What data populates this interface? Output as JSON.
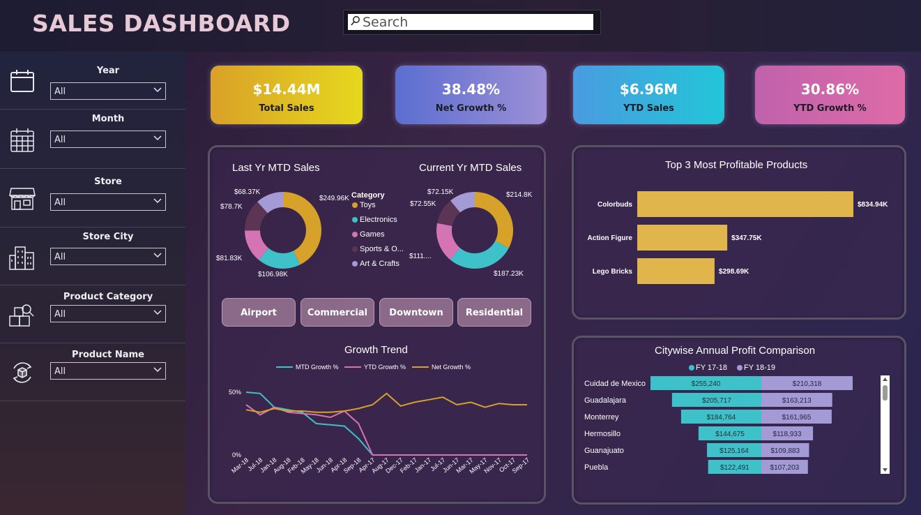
{
  "header": {
    "title": "SALES DASHBOARD",
    "search_placeholder": "Search"
  },
  "filters": [
    {
      "label": "Year",
      "value": "All",
      "icon": "calendar-icon"
    },
    {
      "label": "Month",
      "value": "All",
      "icon": "calendar-grid-icon"
    },
    {
      "label": "Store",
      "value": "All",
      "icon": "storefront-icon"
    },
    {
      "label": "Store City",
      "value": "All",
      "icon": "buildings-icon"
    },
    {
      "label": "Product Category",
      "value": "All",
      "icon": "boxes-search-icon"
    },
    {
      "label": "Product Name",
      "value": "All",
      "icon": "box-cycle-icon"
    }
  ],
  "kpis": [
    {
      "value": "$14.44M",
      "label": "Total Sales",
      "gradient": [
        "#d9a128",
        "#e6d81e"
      ]
    },
    {
      "value": "38.48%",
      "label": "Net Growth %",
      "gradient": [
        "#5b6ed0",
        "#9c8fd6"
      ]
    },
    {
      "value": "$6.96M",
      "label": "YTD Sales",
      "gradient": [
        "#4a9be0",
        "#22c6d8"
      ]
    },
    {
      "value": "30.86%",
      "label": "YTD Growth %",
      "gradient": [
        "#c062ac",
        "#de6ba8"
      ]
    }
  ],
  "colors": {
    "toys": "#d7a22a",
    "electronics": "#3ec1c9",
    "games": "#d474b5",
    "sports": "#5b3553",
    "art": "#a49bd6",
    "bar": "#e0b54c",
    "fy1718": "#3ec1c9",
    "fy1819": "#a49bd6",
    "mtd": "#3ec1c9",
    "ytd": "#d474b5",
    "net": "#d7a22a"
  },
  "donuts": {
    "legend_title": "Category",
    "categories": [
      "Toys",
      "Electronics",
      "Games",
      "Sports & O...",
      "Art & Crafts"
    ],
    "last_yr": {
      "title": "Last Yr MTD Sales",
      "values": [
        249.96,
        106.98,
        81.83,
        78.7,
        68.37
      ],
      "labels": [
        "$249.96K",
        "$106.98K",
        "$81.83K",
        "$78.7K",
        "$68.37K"
      ]
    },
    "current_yr": {
      "title": "Current Yr MTD Sales",
      "values": [
        214.8,
        187.23,
        111.0,
        72.55,
        72.15
      ],
      "labels": [
        "$214.8K",
        "$187.23K",
        "$111....",
        "$72.55K",
        "$72.15K"
      ]
    }
  },
  "stores": [
    "Airport",
    "Commercial",
    "Downtown",
    "Residential"
  ],
  "chart_data": [
    {
      "type": "bar",
      "title": "Top 3 Most Profitable Products",
      "categories": [
        "Colorbuds",
        "Action Figure",
        "Lego Bricks"
      ],
      "values": [
        834.94,
        347.75,
        298.69
      ],
      "labels": [
        "$834.94K",
        "$347.75K",
        "$298.69K"
      ]
    },
    {
      "type": "line",
      "title": "Growth Trend",
      "x": [
        "Mar-18",
        "Jul-18",
        "Jan-18",
        "Aug-18",
        "Feb-18",
        "May-18",
        "Jun-18",
        "Apr-18",
        "Sep-18",
        "Apr-17",
        "Aug-17",
        "Dec-17",
        "Feb-17",
        "Jan-17",
        "Jul-17",
        "Jun-17",
        "Mar-17",
        "May-17",
        "Nov-17",
        "Oct-17",
        "Sep-17"
      ],
      "series": [
        {
          "name": "MTD Growth %",
          "values": [
            50,
            49,
            38,
            36,
            34,
            25,
            24,
            23,
            13,
            0,
            null,
            null,
            null,
            null,
            null,
            null,
            null,
            null,
            null,
            null,
            null
          ]
        },
        {
          "name": "YTD Growth %",
          "values": [
            40,
            32,
            38,
            34,
            33,
            32,
            30,
            35,
            25,
            0,
            0,
            0,
            0,
            0,
            0,
            0,
            0,
            0,
            0,
            0,
            0
          ]
        },
        {
          "name": "Net Growth %",
          "values": [
            36,
            34,
            37,
            35,
            35,
            34,
            34,
            35,
            37,
            40,
            49,
            39,
            42,
            44,
            46,
            40,
            42,
            38,
            41,
            40,
            40
          ]
        }
      ],
      "ytick_labels": [
        "50%",
        "0%"
      ],
      "ylim": [
        0,
        55
      ]
    },
    {
      "type": "bar",
      "title": "Citywise Annual Profit Comparison",
      "categories": [
        "Cuidad de Mexico",
        "Guadalajara",
        "Monterrey",
        "Hermosillo",
        "Guanajuato",
        "Puebla"
      ],
      "series": [
        {
          "name": "FY 17-18",
          "values": [
            255240,
            205717,
            184764,
            144675,
            125164,
            122491
          ],
          "labels": [
            "$255,240",
            "$205,717",
            "$184,764",
            "$144,675",
            "$125,164",
            "$122,491"
          ]
        },
        {
          "name": "FY 18-19",
          "values": [
            210318,
            163213,
            161965,
            118933,
            109883,
            107203
          ],
          "labels": [
            "$210,318",
            "$163,213",
            "$161,965",
            "$118,933",
            "$109,883",
            "$107,203"
          ]
        }
      ]
    }
  ]
}
